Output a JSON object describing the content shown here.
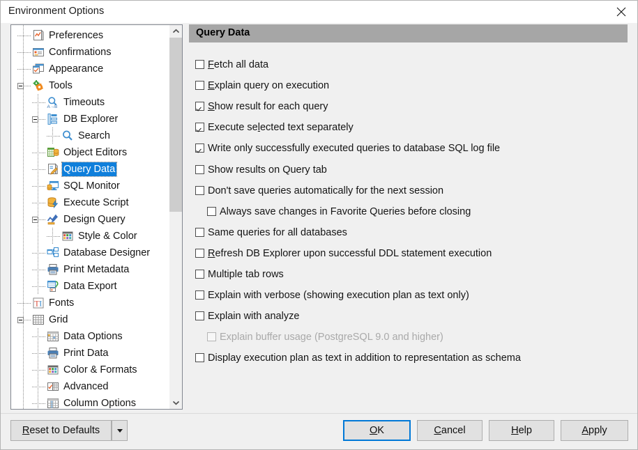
{
  "window": {
    "title": "Environment Options",
    "close_icon": "close-icon"
  },
  "colors": {
    "selection": "#0f7fdb",
    "header_bar": "#a6a6a6",
    "panel_bg": "#f0f0f0",
    "default_button_border": "#0078d7"
  },
  "tree": {
    "scroll_up_icon": "chevron-up-icon",
    "scroll_down_icon": "chevron-down-icon",
    "items": [
      {
        "label": "Preferences",
        "indent": 1,
        "icon": "preferences-icon",
        "expander": "none",
        "selected": false
      },
      {
        "label": "Confirmations",
        "indent": 1,
        "icon": "confirmations-icon",
        "expander": "none",
        "selected": false
      },
      {
        "label": "Appearance",
        "indent": 1,
        "icon": "appearance-icon",
        "expander": "none",
        "selected": false
      },
      {
        "label": "Tools",
        "indent": 1,
        "icon": "tools-icon",
        "expander": "expanded",
        "selected": false
      },
      {
        "label": "Timeouts",
        "indent": 2,
        "icon": "timeouts-icon",
        "expander": "none",
        "selected": false
      },
      {
        "label": "DB Explorer",
        "indent": 2,
        "icon": "db-explorer-icon",
        "expander": "expanded",
        "selected": false
      },
      {
        "label": "Search",
        "indent": 3,
        "icon": "search-icon",
        "expander": "none",
        "selected": false
      },
      {
        "label": "Object Editors",
        "indent": 2,
        "icon": "object-editors-icon",
        "expander": "none",
        "selected": false
      },
      {
        "label": "Query Data",
        "indent": 2,
        "icon": "query-data-icon",
        "expander": "none",
        "selected": true
      },
      {
        "label": "SQL Monitor",
        "indent": 2,
        "icon": "sql-monitor-icon",
        "expander": "none",
        "selected": false
      },
      {
        "label": "Execute Script",
        "indent": 2,
        "icon": "execute-script-icon",
        "expander": "none",
        "selected": false
      },
      {
        "label": "Design Query",
        "indent": 2,
        "icon": "design-query-icon",
        "expander": "expanded",
        "selected": false
      },
      {
        "label": "Style & Color",
        "indent": 3,
        "icon": "style-color-icon",
        "expander": "none",
        "selected": false
      },
      {
        "label": "Database Designer",
        "indent": 2,
        "icon": "database-designer-icon",
        "expander": "none",
        "selected": false
      },
      {
        "label": "Print Metadata",
        "indent": 2,
        "icon": "print-metadata-icon",
        "expander": "none",
        "selected": false
      },
      {
        "label": "Data Export",
        "indent": 2,
        "icon": "data-export-icon",
        "expander": "none",
        "selected": false
      },
      {
        "label": "Fonts",
        "indent": 1,
        "icon": "fonts-icon",
        "expander": "none",
        "selected": false
      },
      {
        "label": "Grid",
        "indent": 1,
        "icon": "grid-icon",
        "expander": "expanded",
        "selected": false
      },
      {
        "label": "Data Options",
        "indent": 2,
        "icon": "data-options-icon",
        "expander": "none",
        "selected": false
      },
      {
        "label": "Print Data",
        "indent": 2,
        "icon": "print-data-icon",
        "expander": "none",
        "selected": false
      },
      {
        "label": "Color & Formats",
        "indent": 2,
        "icon": "color-formats-icon",
        "expander": "none",
        "selected": false
      },
      {
        "label": "Advanced",
        "indent": 2,
        "icon": "advanced-icon",
        "expander": "none",
        "selected": false
      },
      {
        "label": "Column Options",
        "indent": 2,
        "icon": "column-options-icon",
        "expander": "none",
        "selected": false
      }
    ]
  },
  "options": {
    "header": "Query Data",
    "checkboxes": [
      {
        "label": "Fetch all data",
        "accel": "F",
        "checked": false,
        "indent": 0,
        "disabled": false
      },
      {
        "label": "Explain query on execution",
        "accel": "E",
        "checked": false,
        "indent": 0,
        "disabled": false
      },
      {
        "label": "Show result for each query",
        "accel": "S",
        "checked": true,
        "indent": 0,
        "disabled": false
      },
      {
        "label": "Execute selected text separately",
        "accel": "l",
        "checked": true,
        "indent": 0,
        "disabled": false
      },
      {
        "label": "Write only successfully executed queries to database SQL log file",
        "accel": "",
        "checked": true,
        "indent": 0,
        "disabled": false
      },
      {
        "label": "Show results on Query tab",
        "accel": "",
        "checked": false,
        "indent": 0,
        "disabled": false
      },
      {
        "label": "Don't save queries automatically for the next session",
        "accel": "",
        "checked": false,
        "indent": 0,
        "disabled": false
      },
      {
        "label": "Always save changes in Favorite Queries before closing",
        "accel": "",
        "checked": false,
        "indent": 1,
        "disabled": false
      },
      {
        "label": "Same queries for all databases",
        "accel": "",
        "checked": false,
        "indent": 0,
        "disabled": false
      },
      {
        "label": "Refresh DB Explorer upon successful DDL statement execution",
        "accel": "R",
        "checked": false,
        "indent": 0,
        "disabled": false
      },
      {
        "label": "Multiple tab rows",
        "accel": "",
        "checked": false,
        "indent": 0,
        "disabled": false
      },
      {
        "label": "Explain with verbose (showing execution plan as text only)",
        "accel": "",
        "checked": false,
        "indent": 0,
        "disabled": false
      },
      {
        "label": "Explain with analyze",
        "accel": "",
        "checked": false,
        "indent": 0,
        "disabled": false
      },
      {
        "label": "Explain buffer usage (PostgreSQL 9.0 and higher)",
        "accel": "",
        "checked": false,
        "indent": 1,
        "disabled": true
      },
      {
        "label": "Display execution plan as text in addition to representation as schema",
        "accel": "",
        "checked": false,
        "indent": 0,
        "disabled": false
      }
    ]
  },
  "buttons": {
    "reset": "Reset to Defaults",
    "reset_accel": "R",
    "reset_dropdown_icon": "caret-down-icon",
    "ok": "OK",
    "ok_accel": "O",
    "cancel": "Cancel",
    "cancel_accel": "C",
    "help": "Help",
    "help_accel": "H",
    "apply": "Apply",
    "apply_accel": "A"
  }
}
